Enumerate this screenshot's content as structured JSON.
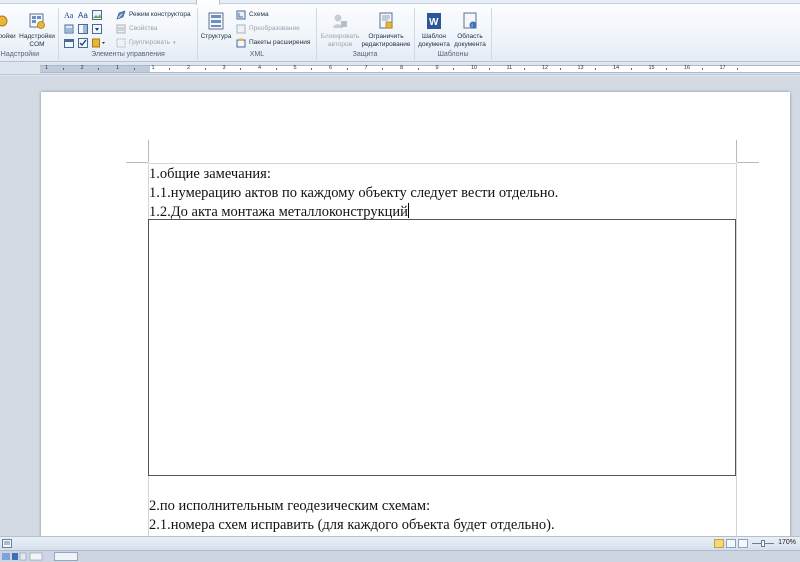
{
  "ribbon": {
    "groups": {
      "addins": "Надстройки",
      "controls": "Элементы управления",
      "xml": "XML",
      "protect": "Защита",
      "templates": "Шаблоны"
    },
    "addins": {
      "addins_clipped": "ройки",
      "com_addins_line1": "Надстройки",
      "com_addins_line2": "COM"
    },
    "controls": {
      "design_mode": "Режим конструктора",
      "properties": "Свойства",
      "group": "Группировать"
    },
    "xml": {
      "structure": "Структура",
      "schema": "Схема",
      "transform": "Преобразование",
      "expansion_packs": "Пакеты расширения"
    },
    "protect": {
      "block_authors_line1": "Блокировать",
      "block_authors_line2": "авторов",
      "restrict_line1": "Ограничить",
      "restrict_line2": "редактирование"
    },
    "templates": {
      "doc_template_line1": "Шаблон",
      "doc_template_line2": "документа",
      "doc_panel_line1": "Область",
      "doc_panel_line2": "документа"
    }
  },
  "ruler": {
    "numbers": [
      "1",
      "2",
      "1",
      "1",
      "2",
      "3",
      "4",
      "5",
      "6",
      "7",
      "8",
      "9",
      "10",
      "11",
      "12",
      "13",
      "14",
      "15",
      "16",
      "17"
    ]
  },
  "document": {
    "line1": "1.общие замечания:",
    "line2": "1.1.нумерацию актов по каждому объекту следует вести отдельно.",
    "line3": "1.2.До акта монтажа металлоконструкций",
    "line4": "2.по исполнительным геодезическим схемам:",
    "line5": "2.1.номера схем исправить (для каждого объекта будет отдельно)."
  },
  "statusbar": {
    "zoom": "170%"
  }
}
